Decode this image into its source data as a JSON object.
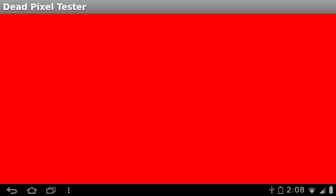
{
  "app": {
    "title": "Dead Pixel Tester"
  },
  "test_screen": {
    "color": "#ff0000"
  },
  "titlebar": {
    "colors": [
      "#a3a3a3",
      "#757575"
    ]
  },
  "system_bar": {
    "buttons": {
      "back": "back-icon",
      "home": "home-icon",
      "recents": "recent-apps-icon",
      "menu": "menu-icon"
    },
    "status_icons": [
      "usb-icon",
      "battery-saver-icon",
      "wifi-icon",
      "signal-icon",
      "battery-icon"
    ],
    "clock": "2:08"
  }
}
